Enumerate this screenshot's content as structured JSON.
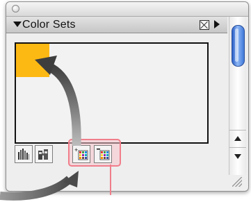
{
  "panel": {
    "title": "Color Sets"
  },
  "swatches": [
    {
      "color": "#fdb913"
    }
  ],
  "toolbar": {
    "buttons": [
      {
        "icon": "color-bars-icon",
        "highlighted": false
      },
      {
        "icon": "color-pair-icon",
        "highlighted": false
      },
      {
        "icon": "add-color-set-icon",
        "highlighted": true
      },
      {
        "icon": "remove-color-set-icon",
        "highlighted": true
      }
    ]
  },
  "icons": {
    "panel_close": "close-box-icon",
    "panel_menu": "menu-triangle-icon",
    "disclosure": "disclosure-triangle-icon",
    "scroll_up": "scroll-up-arrow-icon",
    "scroll_down": "scroll-down-arrow-icon",
    "resize": "resize-grip-icon"
  },
  "colors": {
    "swatch_orange": "#fdb913",
    "highlight": "#f07d8a",
    "arrow": "#6e6e6e",
    "scroll_thumb": "#3f78d8"
  }
}
